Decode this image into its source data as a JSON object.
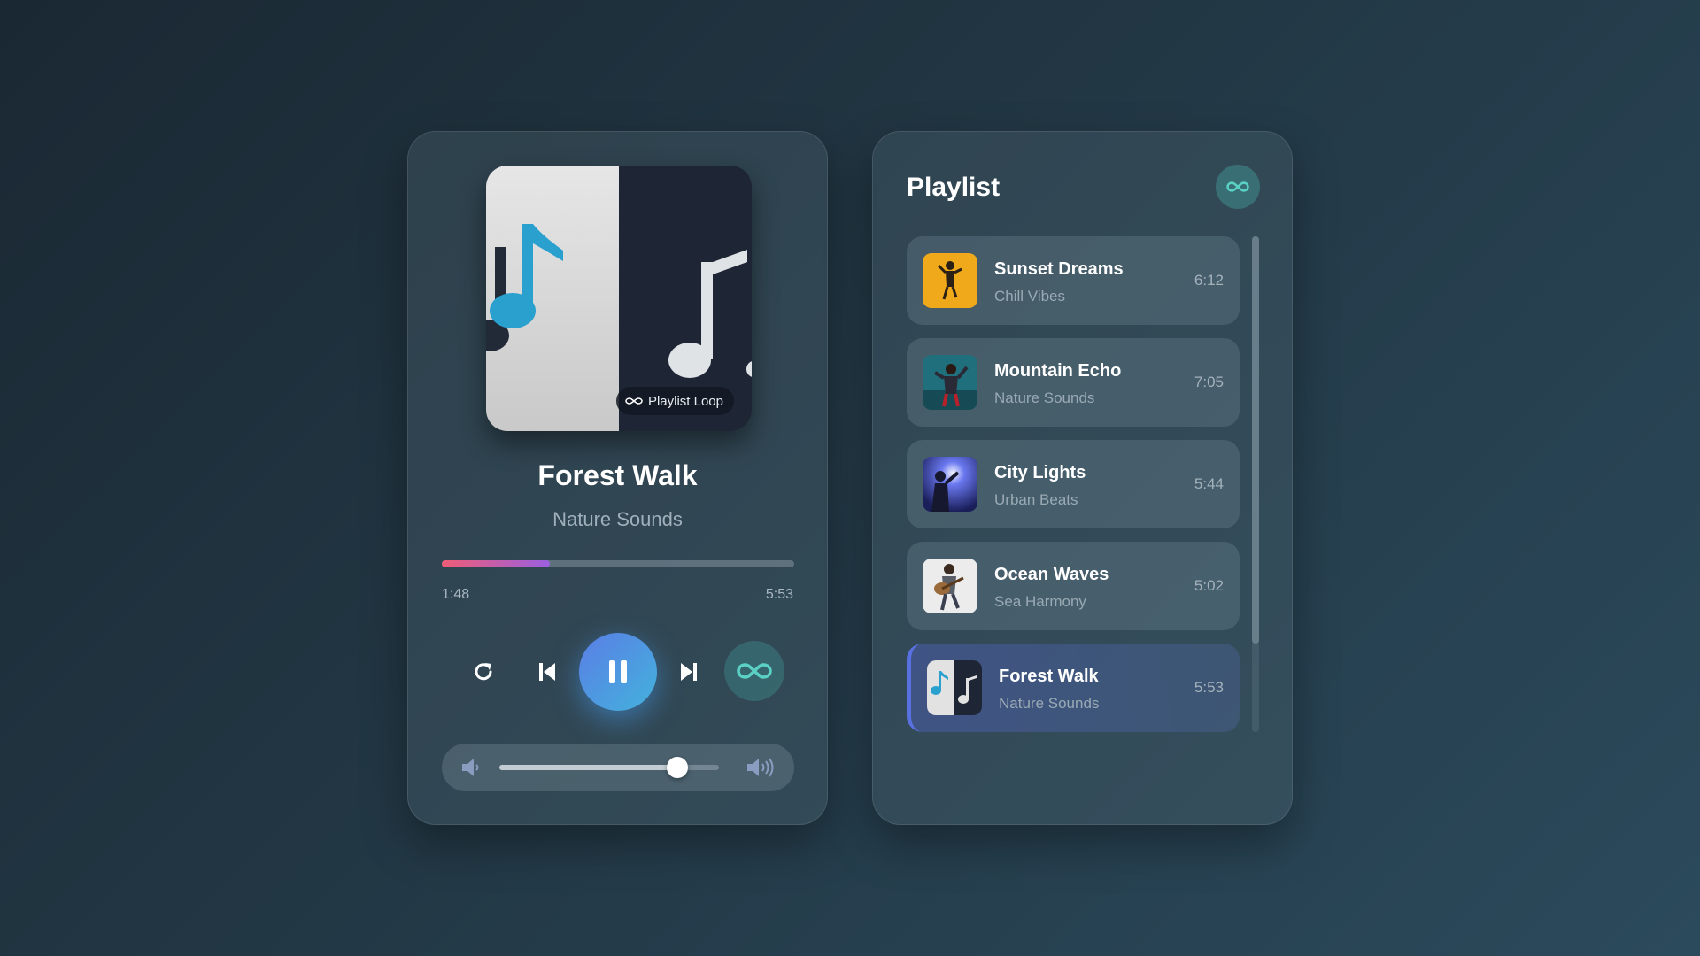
{
  "player": {
    "album_badge": "Playlist Loop",
    "title": "Forest Walk",
    "artist": "Nature Sounds",
    "time_current": "1:48",
    "time_total": "5:53",
    "progress": 0.306,
    "volume": 0.81,
    "controls": [
      "repeat-icon",
      "previous-icon",
      "pause-icon",
      "next-icon",
      "infinity-loop-icon"
    ],
    "volume_icons": [
      "volume-low-icon",
      "volume-high-icon"
    ]
  },
  "playlist": {
    "title": "Playlist",
    "items": [
      {
        "title": "Sunset Dreams",
        "artist": "Chill Vibes",
        "duration": "6:12",
        "active": false
      },
      {
        "title": "Mountain Echo",
        "artist": "Nature Sounds",
        "duration": "7:05",
        "active": false
      },
      {
        "title": "City Lights",
        "artist": "Urban Beats",
        "duration": "5:44",
        "active": false
      },
      {
        "title": "Ocean Waves",
        "artist": "Sea Harmony",
        "duration": "5:02",
        "active": false
      },
      {
        "title": "Forest Walk",
        "artist": "Nature Sounds",
        "duration": "5:53",
        "active": true
      }
    ]
  },
  "colors": {
    "accent_blue": "#4f8fe2",
    "accent_teal": "#5ad1c4",
    "progress_start": "#ef5d76",
    "progress_end": "#9a5fe0",
    "background": "#223744"
  }
}
